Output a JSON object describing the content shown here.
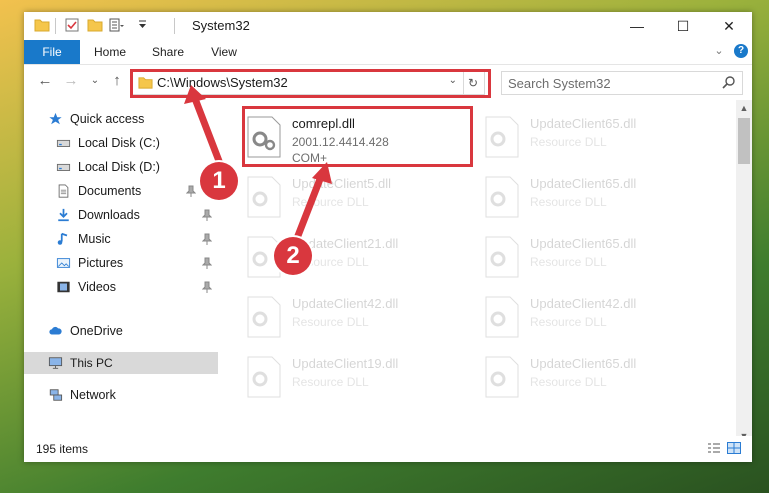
{
  "window": {
    "title": "System32"
  },
  "ribbon": {
    "tabs": [
      "File",
      "Home",
      "Share",
      "View"
    ]
  },
  "address": {
    "path": "C:\\Windows\\System32"
  },
  "search": {
    "placeholder": "Search System32"
  },
  "nav": {
    "quick_access": "Quick access",
    "items": [
      "Local Disk (C:)",
      "Local Disk (D:)",
      "Documents",
      "Downloads",
      "Music",
      "Pictures",
      "Videos"
    ],
    "onedrive": "OneDrive",
    "this_pc": "This PC",
    "network": "Network"
  },
  "files": [
    {
      "name": "comrepl.dll",
      "version": "2001.12.4414.428",
      "type": "COM+"
    },
    {
      "name": "UpdateClient65.dll",
      "type": "Resource DLL"
    },
    {
      "name": "UpdateClient5.dll",
      "type": "Resource DLL"
    },
    {
      "name": "UpdateClient65.dll",
      "type": "Resource DLL"
    },
    {
      "name": "UpdateClient21.dll",
      "type": "Resource DLL"
    },
    {
      "name": "UpdateClient65.dll",
      "type": "Resource DLL"
    },
    {
      "name": "UpdateClient42.dll",
      "type": "Resource DLL"
    },
    {
      "name": "UpdateClient42.dll",
      "type": "Resource DLL"
    },
    {
      "name": "UpdateClient19.dll",
      "type": "Resource DLL"
    },
    {
      "name": "UpdateClient65.dll",
      "type": "Resource DLL"
    }
  ],
  "status": {
    "count": "195 items"
  },
  "annotations": {
    "step1": "1",
    "step2": "2",
    "color": "#d9373e"
  },
  "colors": {
    "file_tab": "#1979ca",
    "selected_nav": "#d9d9d9"
  }
}
